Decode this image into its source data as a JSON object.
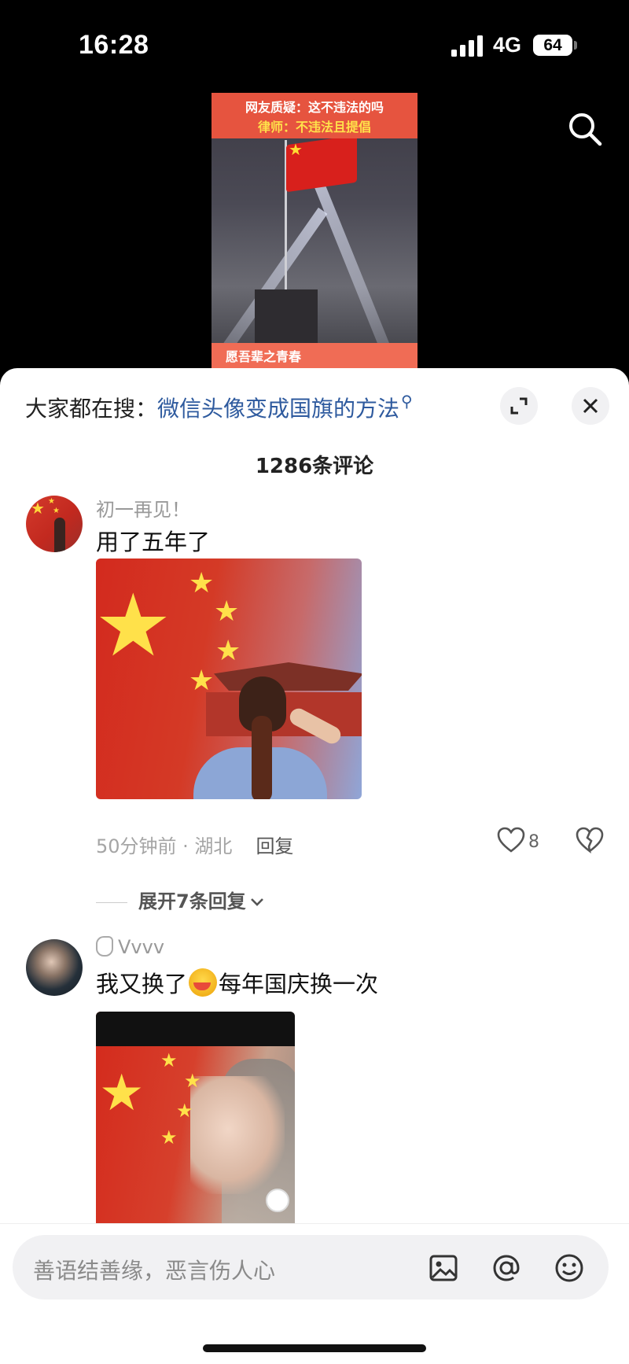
{
  "status_bar": {
    "time": "16:28",
    "network": "4G",
    "battery": "64"
  },
  "video": {
    "banner_line1": "网友质疑：这不违法的吗",
    "banner_line2": "律师：不违法且提倡",
    "bottom_caption": "愿吾辈之青春"
  },
  "sheet": {
    "hot_search_prefix": "大家都在搜：",
    "hot_search_query": "微信头像变成国旗的方法",
    "comment_count": "1286条评论"
  },
  "comments": [
    {
      "username": "初一再见！",
      "text": "用了五年了",
      "time_location": "50分钟前 · 湖北",
      "reply_label": "回复",
      "likes": "8",
      "expand_replies": "展开7条回复"
    },
    {
      "username": "Vvvv",
      "text_before_emoji": "我又换了",
      "text_after_emoji": "每年国庆换一次"
    }
  ],
  "input": {
    "placeholder": "善语结善缘，恶言伤人心"
  },
  "colors": {
    "link_blue": "#2e5a9e",
    "flag_red": "#d32a1e",
    "star_yellow": "#ffe14a"
  },
  "icons": [
    "search-icon",
    "expand-icon",
    "close-icon",
    "heart-icon",
    "broken-heart-icon",
    "chevron-down-icon",
    "image-icon",
    "at-icon",
    "emoji-icon"
  ]
}
